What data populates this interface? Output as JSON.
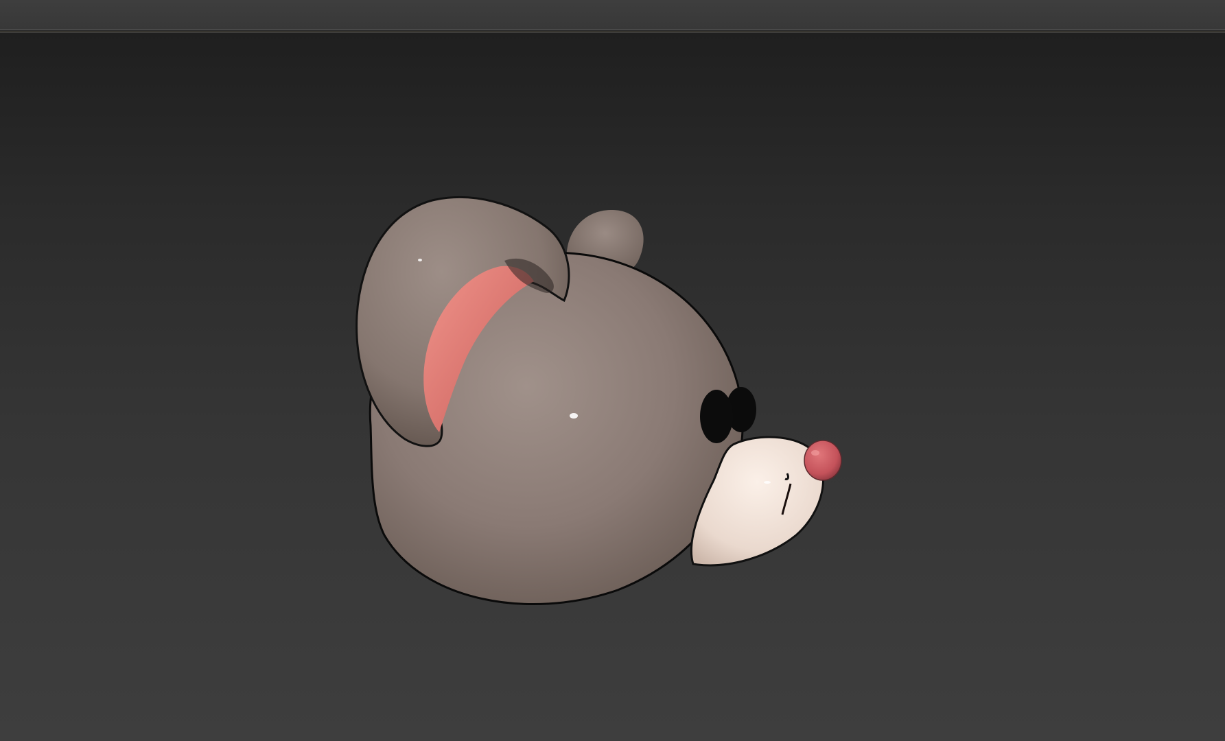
{
  "app": {
    "title": "",
    "viewport_label": ""
  },
  "scene": {
    "object": "mouse-head-model",
    "colors": {
      "fur": "#8a7a74",
      "inner_ear": "#e07f78",
      "muzzle": "#f1e3da",
      "nose": "#c9545a",
      "eye": "#0c0c0c",
      "viewport_top": "#1f1f1f",
      "viewport_bottom": "#3e3e3e"
    }
  }
}
